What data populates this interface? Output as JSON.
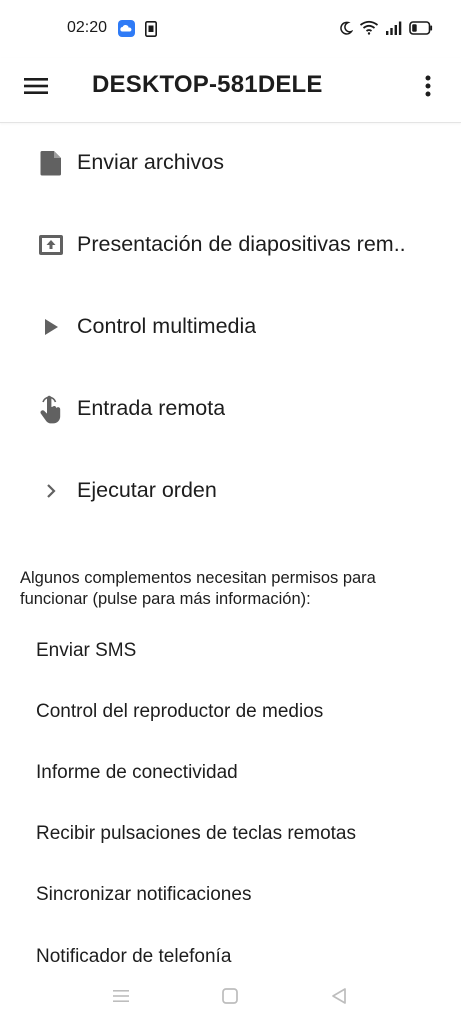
{
  "status_bar": {
    "time": "02:20",
    "left_icons": [
      "cloud-app-icon",
      "sim-card-icon"
    ],
    "right_icons": [
      "moon-icon",
      "wifi-icon",
      "signal-icon",
      "battery-icon"
    ]
  },
  "app_bar": {
    "title": "DESKTOP-581DELE",
    "menu_icon": "hamburger-menu-icon",
    "overflow_icon": "more-vertical-icon"
  },
  "plugins": [
    {
      "label": "Enviar archivos",
      "icon": "file-icon"
    },
    {
      "label": "Presentación de diapositivas rem..",
      "icon": "presentation-icon"
    },
    {
      "label": "Control multimedia",
      "icon": "play-icon"
    },
    {
      "label": "Entrada remota",
      "icon": "touch-hand-icon"
    },
    {
      "label": "Ejecutar orden",
      "icon": "chevron-right-icon"
    }
  ],
  "permissions": {
    "note": "Algunos complementos necesitan permisos para funcionar (pulse para más información):",
    "items": [
      {
        "label": "Enviar SMS"
      },
      {
        "label": "Control del reproductor de medios"
      },
      {
        "label": "Informe de conectividad"
      },
      {
        "label": "Recibir pulsaciones de teclas remotas"
      },
      {
        "label": "Sincronizar notificaciones"
      },
      {
        "label": "Notificador de telefonía"
      }
    ]
  },
  "colors": {
    "icon_gray": "#616161",
    "text": "#1d1d1d",
    "background": "#ffffff",
    "nav_icon": "#bdbdbd"
  },
  "nav_bar": {
    "icons": [
      "recents-menu-icon",
      "home-square-icon",
      "back-triangle-icon"
    ]
  }
}
